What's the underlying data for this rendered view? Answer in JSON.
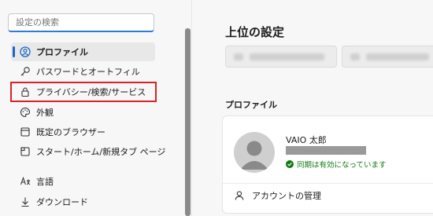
{
  "search": {
    "placeholder": "設定の検索"
  },
  "sidebar": {
    "items": [
      {
        "label": "プロファイル",
        "icon": "profile-icon"
      },
      {
        "label": "パスワードとオートフィル",
        "icon": "key-icon"
      },
      {
        "label": "プライバシー/検索/サービス",
        "icon": "lock-icon"
      },
      {
        "label": "外観",
        "icon": "palette-icon"
      },
      {
        "label": "既定のブラウザー",
        "icon": "browser-icon"
      },
      {
        "label": "スタート/ホーム/新規タブ ページ",
        "icon": "home-tab-icon"
      },
      {
        "label": "言語",
        "icon": "language-icon"
      },
      {
        "label": "ダウンロード",
        "icon": "download-icon"
      }
    ]
  },
  "main": {
    "title": "上位の設定",
    "profile_section_label": "プロファイル",
    "profile": {
      "name": "VAIO 太郎",
      "sync_status": "同期は有効になっています",
      "manage_label": "アカウントの管理"
    }
  },
  "colors": {
    "accent": "#1a66c7",
    "highlight_box": "#d8222a",
    "sync_green": "#107c10"
  }
}
